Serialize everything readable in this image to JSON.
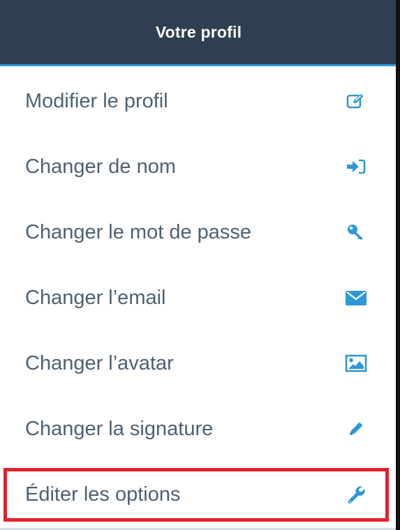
{
  "header": {
    "title": "Votre profil"
  },
  "colors": {
    "header_bg": "#2f3e51",
    "accent": "#2e97d6",
    "text": "#4f6173",
    "highlight": "#e5202e"
  },
  "menu": {
    "items": [
      {
        "label": "Modifier le profil",
        "icon": "edit-icon"
      },
      {
        "label": "Changer de nom",
        "icon": "sign-in-icon"
      },
      {
        "label": "Changer le mot de passe",
        "icon": "key-icon"
      },
      {
        "label": "Changer l’email",
        "icon": "envelope-icon"
      },
      {
        "label": "Changer l’avatar",
        "icon": "image-icon"
      },
      {
        "label": "Changer la signature",
        "icon": "pencil-icon"
      },
      {
        "label": "Éditer les options",
        "icon": "wrench-icon",
        "highlighted": true
      }
    ]
  }
}
